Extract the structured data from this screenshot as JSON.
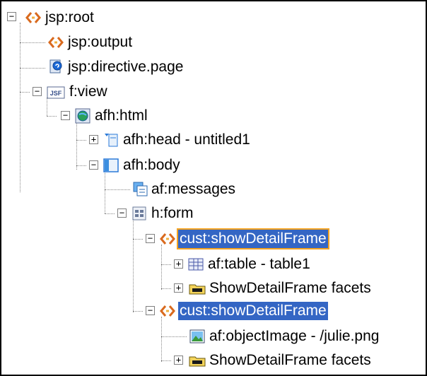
{
  "tree": {
    "nodes": [
      {
        "label": "jsp:root",
        "icon": "jsp-tag-icon",
        "toggle": "−"
      },
      {
        "label": "jsp:output",
        "icon": "jsp-tag-icon"
      },
      {
        "label": "jsp:directive.page",
        "icon": "directive-page-icon"
      },
      {
        "label": "f:view",
        "icon": "jsf-icon",
        "toggle": "−"
      },
      {
        "label": "afh:html",
        "icon": "globe-icon",
        "toggle": "−"
      },
      {
        "label": "afh:head - untitled1",
        "icon": "head-icon",
        "toggle": "+"
      },
      {
        "label": "afh:body",
        "icon": "body-panel-icon",
        "toggle": "−"
      },
      {
        "label": "af:messages",
        "icon": "messages-icon"
      },
      {
        "label": "h:form",
        "icon": "form-icon",
        "toggle": "−"
      },
      {
        "label": "cust:showDetailFrame",
        "icon": "jsp-tag-icon",
        "toggle": "−",
        "selected": "focus"
      },
      {
        "label": "af:table - table1",
        "icon": "table-icon",
        "toggle": "+"
      },
      {
        "label": "ShowDetailFrame facets",
        "icon": "folder-icon",
        "toggle": "+"
      },
      {
        "label": "cust:showDetailFrame",
        "icon": "jsp-tag-icon",
        "toggle": "−",
        "selected": "selected"
      },
      {
        "label": "af:objectImage - /julie.png",
        "icon": "image-icon"
      },
      {
        "label": "ShowDetailFrame facets",
        "icon": "folder-icon",
        "toggle": "+"
      }
    ]
  },
  "colors": {
    "selection": "#3466c4",
    "focus_border": "#f5a320",
    "tree_lines": "#888888"
  }
}
